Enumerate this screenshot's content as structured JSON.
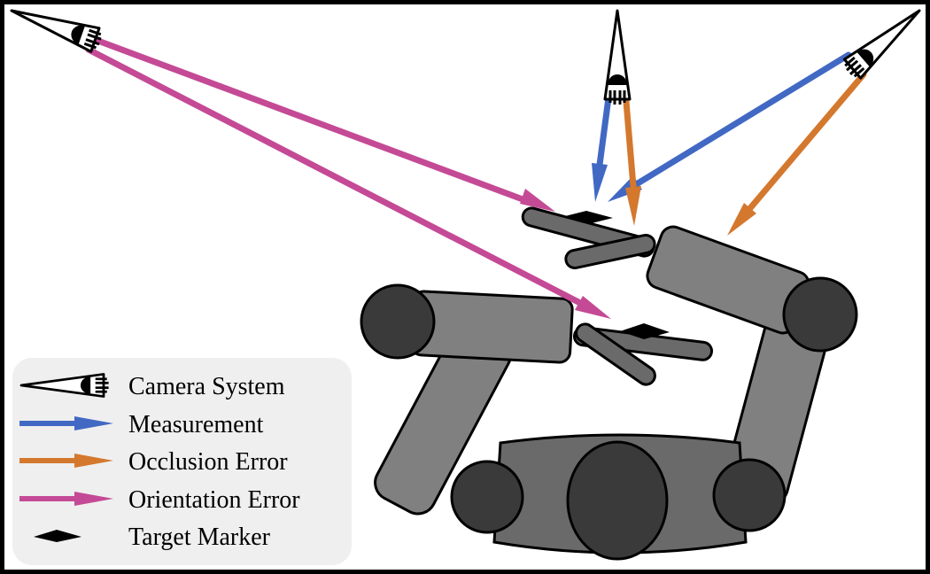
{
  "legend": {
    "camera_system": "Camera System",
    "measurement": "Measurement",
    "occlusion_error": "Occlusion Error",
    "orientation_error": "Orientation Error",
    "target_marker": "Target Marker"
  },
  "colors": {
    "measurement": "#4169c4",
    "occlusion_error": "#d4782e",
    "orientation_error": "#c44a96",
    "robot_dark": "#3a3a3a",
    "robot_light": "#808080",
    "robot_gripper": "#6a6a6a",
    "legend_bg": "#efefef",
    "marker": "#000000"
  },
  "icons": {
    "camera": "camera-eye-icon",
    "marker": "diamond-marker-icon"
  }
}
